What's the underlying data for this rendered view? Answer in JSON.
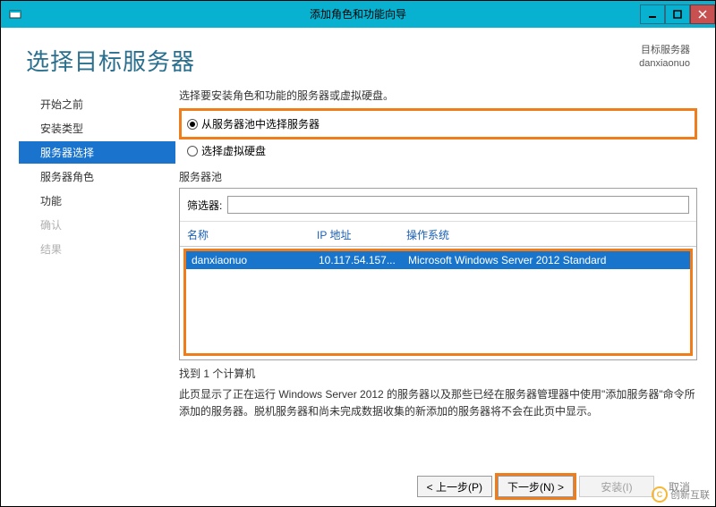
{
  "window": {
    "title": "添加角色和功能向导"
  },
  "header": {
    "page_title": "选择目标服务器",
    "right_label": "目标服务器",
    "right_value": "danxiaonuo"
  },
  "sidebar": {
    "items": [
      {
        "label": "开始之前",
        "active": false,
        "disabled": false
      },
      {
        "label": "安装类型",
        "active": false,
        "disabled": false
      },
      {
        "label": "服务器选择",
        "active": true,
        "disabled": false
      },
      {
        "label": "服务器角色",
        "active": false,
        "disabled": false
      },
      {
        "label": "功能",
        "active": false,
        "disabled": false
      },
      {
        "label": "确认",
        "active": false,
        "disabled": true
      },
      {
        "label": "结果",
        "active": false,
        "disabled": true
      }
    ]
  },
  "main": {
    "instruction": "选择要安装角色和功能的服务器或虚拟硬盘。",
    "radio1": "从服务器池中选择服务器",
    "radio2": "选择虚拟硬盘",
    "pool_label": "服务器池",
    "filter_label": "筛选器:",
    "columns": {
      "name": "名称",
      "ip": "IP 地址",
      "os": "操作系统"
    },
    "rows": [
      {
        "name": "danxiaonuo",
        "ip": "10.117.54.157...",
        "os": "Microsoft Windows Server 2012 Standard"
      }
    ],
    "found": "找到 1 个计算机",
    "description": "此页显示了正在运行 Windows Server 2012 的服务器以及那些已经在服务器管理器中使用\"添加服务器\"命令所添加的服务器。脱机服务器和尚未完成数据收集的新添加的服务器将不会在此页中显示。"
  },
  "footer": {
    "prev": "< 上一步(P)",
    "next": "下一步(N) >",
    "install": "安装(I)",
    "cancel": "取消"
  },
  "watermark": "创新互联"
}
